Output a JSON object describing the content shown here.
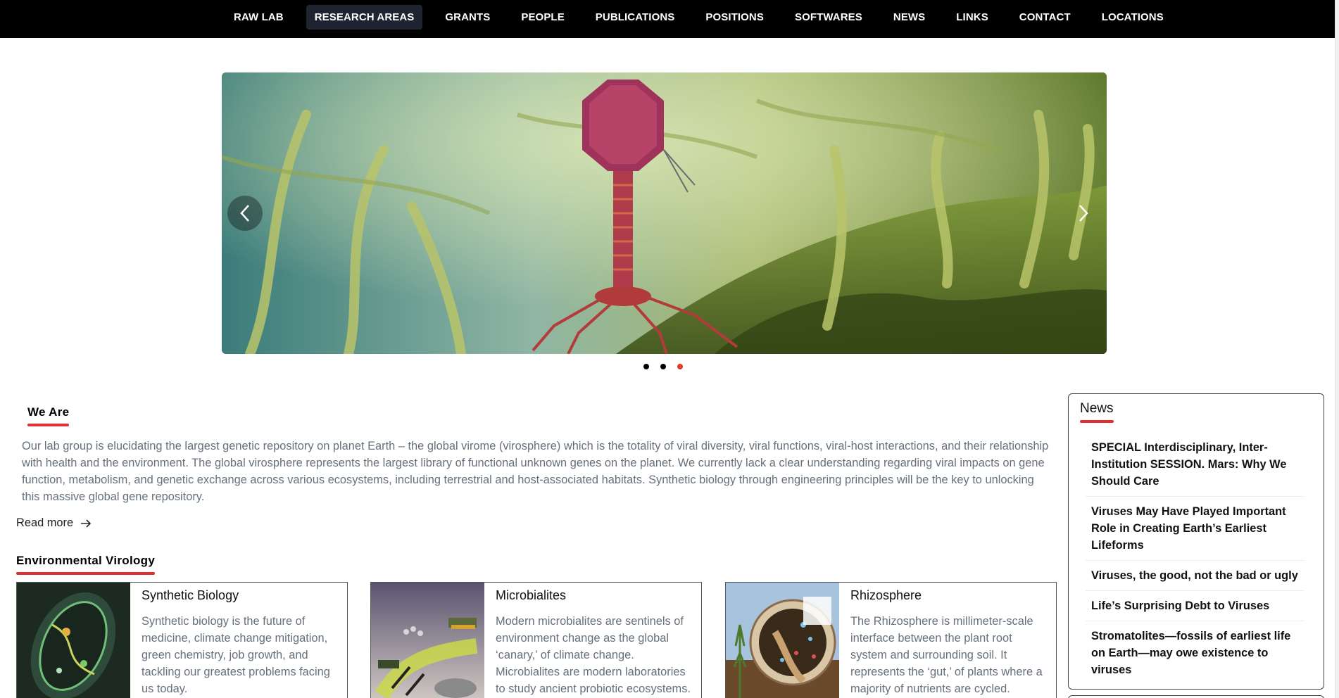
{
  "nav": {
    "items": [
      {
        "label": "RAW LAB"
      },
      {
        "label": "RESEARCH AREAS",
        "active": true
      },
      {
        "label": "GRANTS"
      },
      {
        "label": "PEOPLE"
      },
      {
        "label": "PUBLICATIONS"
      },
      {
        "label": "POSITIONS"
      },
      {
        "label": "SOFTWARES"
      },
      {
        "label": "NEWS"
      },
      {
        "label": "LINKS"
      },
      {
        "label": "CONTACT"
      },
      {
        "label": "LOCATIONS"
      }
    ]
  },
  "carousel": {
    "slide_count": 3,
    "active_slide": 3,
    "icons": {
      "prev": "chevron-left-icon",
      "next": "chevron-right-icon"
    }
  },
  "we_are": {
    "heading": "We Are",
    "text": "Our lab group is elucidating the largest genetic repository on planet Earth – the global virome (virosphere) which is the totality of viral diversity, viral functions, viral-host interactions, and their relationship with health and the environment. The global virosphere represents the largest library of functional unknown genes on the planet. We currently lack a clear understanding regarding viral impacts on gene function, metabolism, and genetic exchange across various ecosystems, including terrestrial and host-associated habitats. Synthetic biology through engineering principles will be the key to unlocking this massive global gene repository.",
    "read_more": "Read more",
    "read_more_icon": "arrow-right-icon"
  },
  "environmental": {
    "heading": "Environmental Virology",
    "cards": [
      {
        "title": "Synthetic Biology",
        "text": "Synthetic biology is the future of medicine, climate change mitigation, green chemistry, job growth, and tackling our greatest problems facing us today."
      },
      {
        "title": "Microbialites",
        "text": "Modern microbialites are sentinels of environment change as the global ‘canary,’ of climate change. Microbialites are modern laboratories to study ancient probiotic ecosystems."
      },
      {
        "title": "Rhizosphere",
        "text": "The Rhizosphere is millimeter-scale interface between the plant root system and surrounding soil. It represents the ‘gut,’ of plants where a majority of nutrients are cycled."
      }
    ]
  },
  "news": {
    "title": "News",
    "items": [
      "SPECIAL Interdisciplinary, Inter-Institution SESSION. Mars: Why We Should Care",
      "Viruses May Have Played Important Role in Creating Earth’s Earliest Lifeforms",
      "Viruses, the good, not the bad or ugly",
      "Life’s Surprising Debt to Viruses",
      "Stromatolites—fossils of earliest life on Earth—may owe existence to viruses"
    ]
  },
  "colors": {
    "accent": "#e22f2f",
    "nav_bg": "#000000",
    "muted_text": "#66707c"
  }
}
